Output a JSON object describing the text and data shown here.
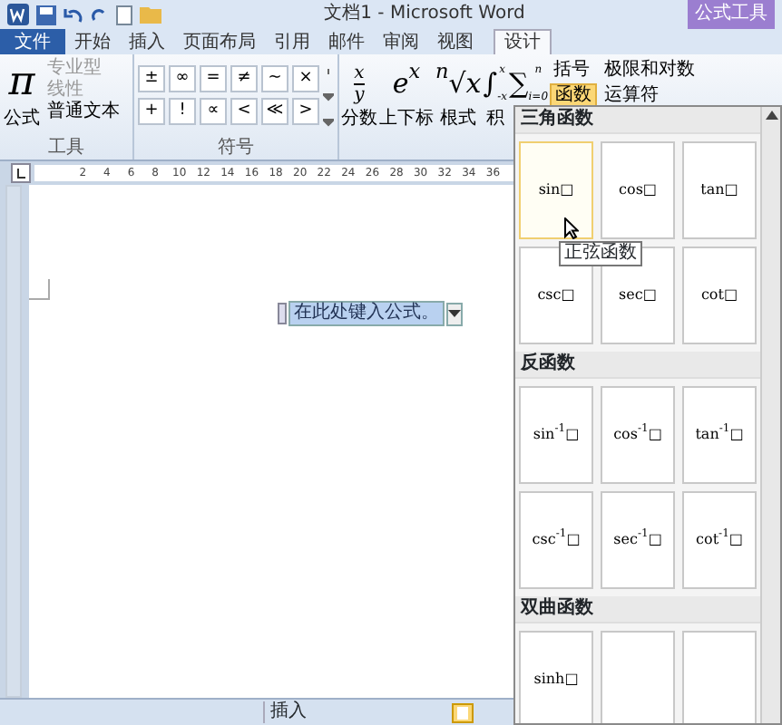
{
  "window": {
    "title": "文档1 - Microsoft Word",
    "contextual_tab": "公式工具"
  },
  "tabs": [
    {
      "label": "文件",
      "kind": "file",
      "selected": false
    },
    {
      "label": "开始",
      "kind": "tab",
      "selected": false
    },
    {
      "label": "插入",
      "kind": "tab",
      "selected": false
    },
    {
      "label": "页面布局",
      "kind": "tab",
      "selected": false
    },
    {
      "label": "引用",
      "kind": "tab",
      "selected": false
    },
    {
      "label": "邮件",
      "kind": "tab",
      "selected": false
    },
    {
      "label": "审阅",
      "kind": "tab",
      "selected": false
    },
    {
      "label": "视图",
      "kind": "tab",
      "selected": false
    },
    {
      "label": "设计",
      "kind": "tab",
      "selected": true
    }
  ],
  "tools_group": {
    "label": "工具",
    "main": {
      "glyph": "π",
      "label": "公式"
    },
    "items": [
      {
        "label": "专业型",
        "disabled": true
      },
      {
        "label": "线性",
        "disabled": true
      },
      {
        "label": "普通文本",
        "disabled": false
      }
    ]
  },
  "symbols_group": {
    "label": "符号",
    "symbols": [
      "±",
      "∞",
      "=",
      "≠",
      "~",
      "×",
      "+",
      "!",
      "∝",
      "<",
      "≪",
      ">"
    ]
  },
  "structures": [
    {
      "kind": "fraction",
      "top": "x",
      "bottom": "y",
      "label": "分数"
    },
    {
      "kind": "glyph",
      "glyph": "e$^{x}$",
      "label": "上下标"
    },
    {
      "kind": "glyph",
      "glyph": "$^{n}$√x",
      "label": "根式"
    },
    {
      "kind": "limits",
      "glyph": "∫",
      "sup": "x",
      "sub": "-x",
      "label": "积"
    },
    {
      "kind": "limits",
      "glyph": "∑",
      "sup": "n",
      "sub": "i=0"
    }
  ],
  "small_buttons": [
    {
      "label": "括号",
      "active": false
    },
    {
      "label": "函数",
      "active": true
    },
    {
      "label": "极限和对数",
      "active": false
    },
    {
      "label": "运算符",
      "active": false
    }
  ],
  "ruler": [
    "2",
    "4",
    "6",
    "8",
    "10",
    "12",
    "14",
    "16",
    "18",
    "20",
    "22",
    "24",
    "26",
    "28",
    "30",
    "32",
    "34",
    "36"
  ],
  "equation": {
    "placeholder": "在此处键入公式。"
  },
  "gallery": {
    "sections": [
      {
        "title": "三角函数",
        "items": [
          {
            "text": "sin□",
            "hovered": true
          },
          {
            "text": "cos□",
            "hovered": false
          },
          {
            "text": "tan□",
            "hovered": false
          },
          {
            "text": "csc□",
            "hovered": false
          },
          {
            "text": "sec□",
            "hovered": false
          },
          {
            "text": "cot□",
            "hovered": false
          }
        ]
      },
      {
        "title": "反函数",
        "items": [
          {
            "text": "sin$^{-1}$□",
            "hovered": false
          },
          {
            "text": "cos$^{-1}$□",
            "hovered": false
          },
          {
            "text": "tan$^{-1}$□",
            "hovered": false
          },
          {
            "text": "csc$^{-1}$□",
            "hovered": false
          },
          {
            "text": "sec$^{-1}$□",
            "hovered": false
          },
          {
            "text": "cot$^{-1}$□",
            "hovered": false
          }
        ]
      },
      {
        "title": "双曲函数",
        "items": [
          {
            "text": "sinh□",
            "hovered": false
          },
          {
            "hovered": false
          },
          {
            "hovered": false
          }
        ]
      }
    ]
  },
  "tooltip": "正弦函数",
  "status_bar": [
    "插入"
  ]
}
